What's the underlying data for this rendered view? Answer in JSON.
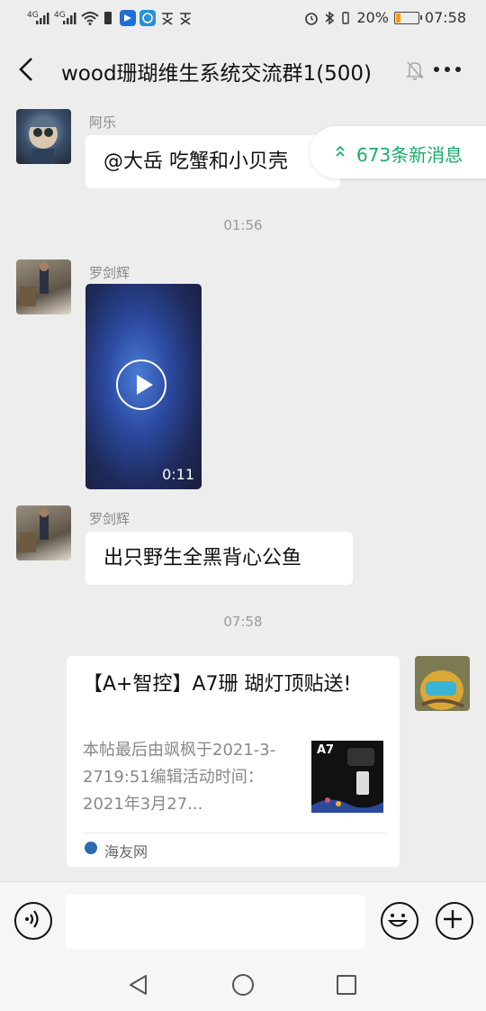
{
  "status_bar": {
    "signal_1": "4G",
    "signal_2": "4G",
    "battery": "20%",
    "time": "07:58",
    "icons": [
      "alarm-icon",
      "bluetooth-icon",
      "vibrate-icon"
    ]
  },
  "header": {
    "title": "wood珊瑚维生系统交流群1(500)",
    "icons": [
      "back-arrow-icon",
      "muted-bell-icon",
      "more-icon"
    ]
  },
  "new_messages_pill": {
    "label": "673条新消息",
    "icon": "double-chevron-up-icon"
  },
  "messages": [
    {
      "type": "text",
      "sender": "阿乐",
      "text": "@大岳  吃蟹和小贝壳"
    },
    {
      "type": "time",
      "text": "01:56"
    },
    {
      "type": "video",
      "sender": "罗剑辉",
      "duration": "0:11"
    },
    {
      "type": "text",
      "sender": "罗剑辉",
      "text": "出只野生全黑背心公鱼"
    },
    {
      "type": "time",
      "text": "07:58"
    },
    {
      "type": "link_card",
      "title": "【A+智控】A7珊 瑚灯顶贴送!",
      "description": "本帖最后由飒枫于2021-3-2719:51编辑活动时间：2021年3月27...",
      "thumbnail_label": "A7",
      "source": "海友网"
    }
  ],
  "input_bar": {
    "icons": [
      "voice-icon",
      "emoji-icon",
      "plus-icon"
    ],
    "placeholder": ""
  },
  "system_nav": {
    "icons": [
      "nav-back-icon",
      "nav-home-icon",
      "nav-recents-icon"
    ]
  },
  "colors": {
    "accent_green": "#1aad6a",
    "background": "#ededed"
  }
}
